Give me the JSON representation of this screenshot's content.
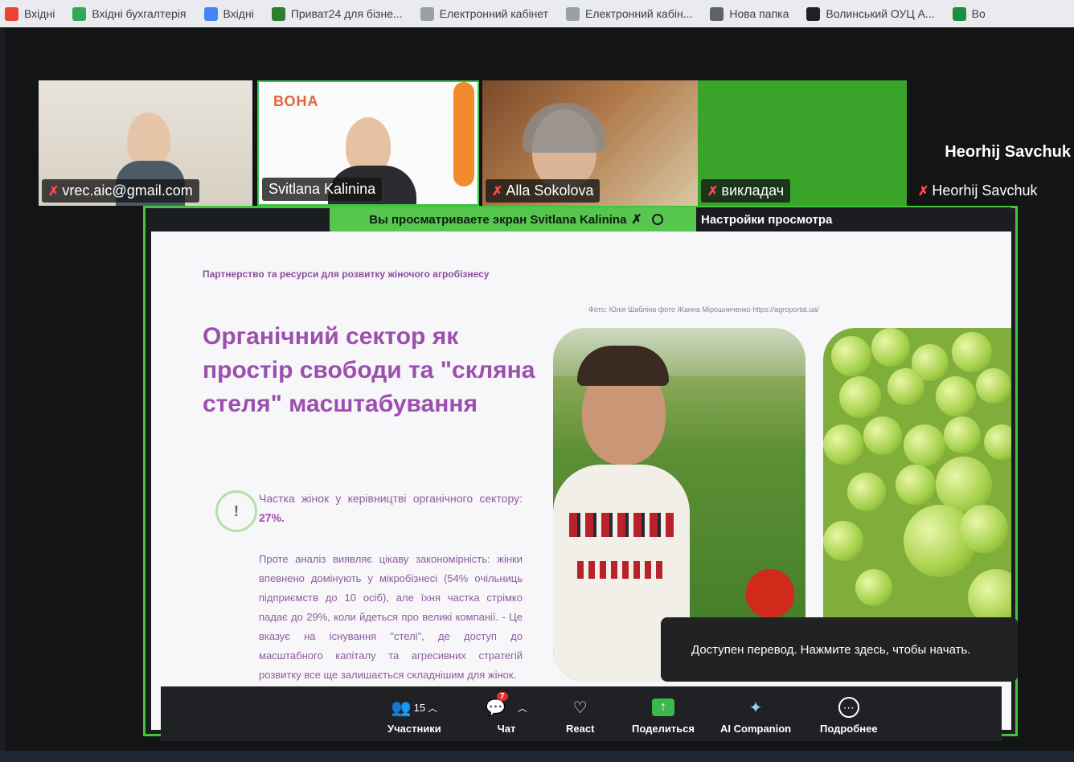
{
  "bookmarks": [
    {
      "label": "Вхідні",
      "color": "#ea4335"
    },
    {
      "label": "Вхідні бухгалтерія",
      "color": "#34a853"
    },
    {
      "label": "Вхідні",
      "color": "#4285f4"
    },
    {
      "label": "Приват24 для бізне...",
      "color": "#2e7d32"
    },
    {
      "label": "Електронний кабінет",
      "color": "#9aa0a6"
    },
    {
      "label": "Електронний кабін...",
      "color": "#9aa0a6"
    },
    {
      "label": "Нова папка",
      "color": "#5f6368"
    },
    {
      "label": "Волинський ОУЦ А...",
      "color": "#202124"
    },
    {
      "label": "Во",
      "color": "#1e8e3e"
    }
  ],
  "participants": {
    "p1": "vrec.aic@gmail.com",
    "p2": "Svitlana Kalinina",
    "p2_logo": "ВОНА",
    "p3": "Alla Sokolova",
    "p4": "викладач",
    "p5_big": "Heorhij Savchuk",
    "p5": "Heorhij Savchuk"
  },
  "share": {
    "banner": "Вы просматриваете экран  Svitlana Kalinina",
    "view_settings": "Настройки просмотра"
  },
  "slide": {
    "subtitle": "Партнерство та ресурси для розвитку жіночого агробізнесу",
    "photo_credit": "Фото: Юлія Шабліна фото Жанна Мірошниченко https://agroportal.ua/",
    "headline": "Органічний сектор як простір свободи та \"скляна стеля\" масштабування",
    "alert_symbol": "!",
    "stat_text": "Частка жінок у керівництві органічного сектору:",
    "stat_value": "27%.",
    "paragraph": "Проте аналіз виявляє цікаву закономірність: жінки впевнено домінують у мікробізнесі (54% очільниць підприємств до 10 осіб), але їхня частка стрімко падає до 29%, коли йдеться про великі компанії. - Це вказує на існування \"стелі\", де доступ до масштабного капіталу та агресивних стратегій розвитку все ще залишається складнішим для жінок."
  },
  "tooltip": "Доступен перевод. Нажмите здесь, чтобы начать.",
  "toolbar": {
    "participants_label": "Участники",
    "participants_count": "15",
    "chat_label": "Чат",
    "chat_badge": "7",
    "react_label": "React",
    "share_label": "Поделиться",
    "ai_label": "AI Companion",
    "more_label": "Подробнее"
  },
  "colors": {
    "accent_green": "#56c64f",
    "slide_purple": "#9b4fae",
    "mic_red": "#ff4a4a"
  }
}
